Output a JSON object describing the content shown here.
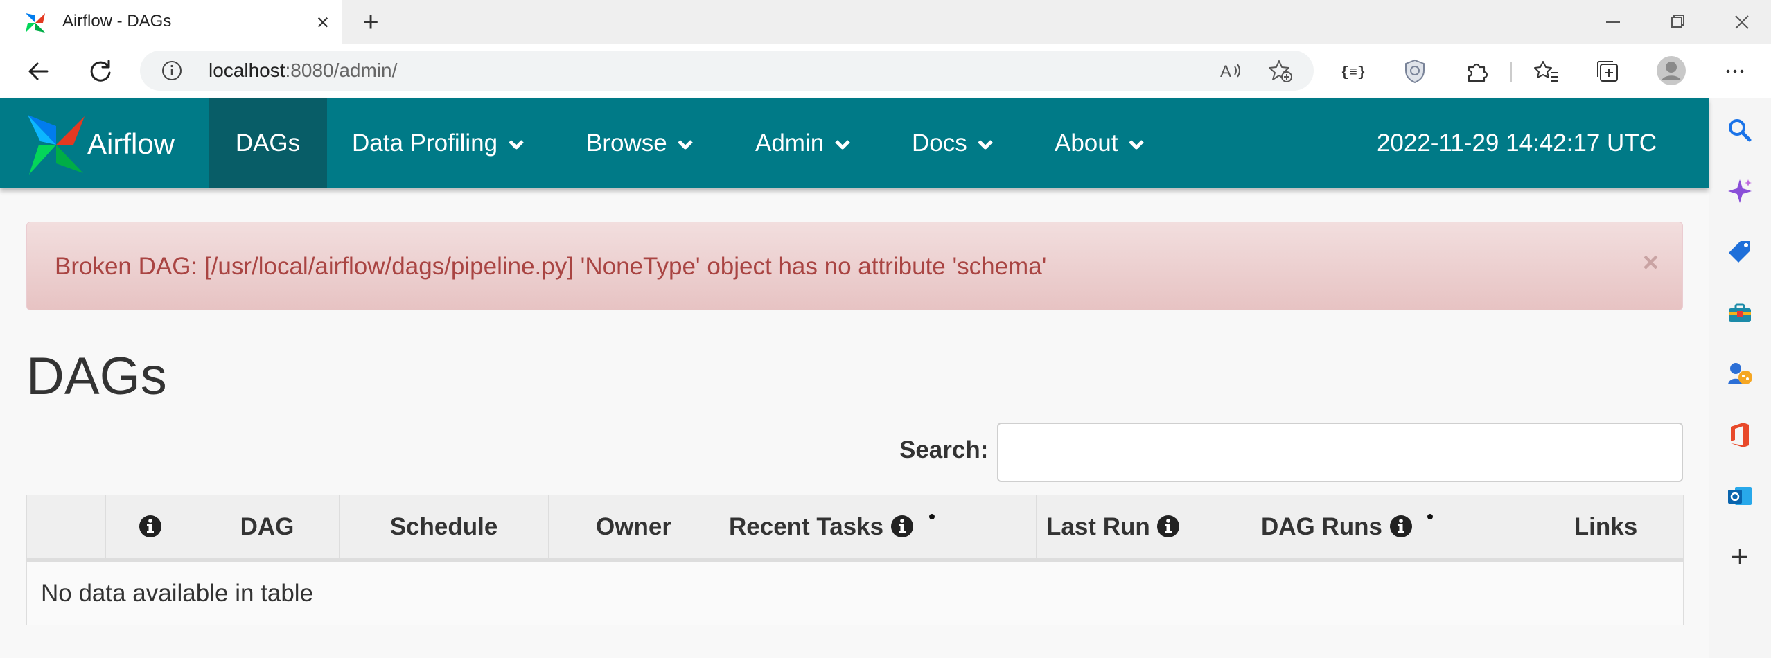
{
  "browser": {
    "tab_title": "Airflow - DAGs",
    "url_host": "localhost",
    "url_path": ":8080/admin/"
  },
  "navbar": {
    "brand": "Airflow",
    "items": [
      {
        "label": "DAGs",
        "active": true
      },
      {
        "label": "Data Profiling",
        "dropdown": true
      },
      {
        "label": "Browse",
        "dropdown": true
      },
      {
        "label": "Admin",
        "dropdown": true
      },
      {
        "label": "Docs",
        "dropdown": true
      },
      {
        "label": "About",
        "dropdown": true
      }
    ],
    "clock": "2022-11-29 14:42:17 UTC"
  },
  "alert": {
    "message": "Broken DAG: [/usr/local/airflow/dags/pipeline.py] 'NoneType' object has no attribute 'schema'",
    "close": "×"
  },
  "page": {
    "title": "DAGs",
    "search_label": "Search:",
    "search_value": ""
  },
  "table": {
    "columns": [
      "",
      "",
      "DAG",
      "Schedule",
      "Owner",
      "Recent Tasks",
      "Last Run",
      "DAG Runs",
      "Links"
    ],
    "empty_message": "No data available in table"
  },
  "colors": {
    "navbar": "#007a87",
    "navbar_active": "#085d67",
    "alert_bg": "#f2dede",
    "alert_text": "#a94442"
  }
}
